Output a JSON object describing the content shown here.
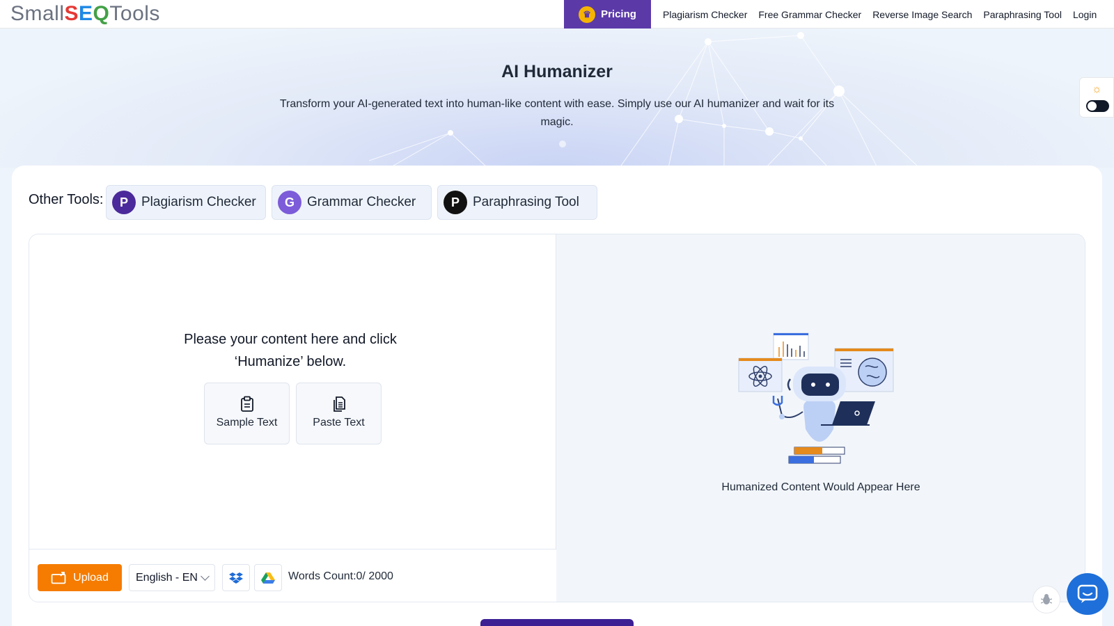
{
  "header": {
    "logo_prefix": "Small",
    "logo_s": "S",
    "logo_e": "E",
    "logo_o": "Q",
    "logo_suffix": "Tools",
    "pricing_label": "Pricing",
    "nav": [
      "Plagiarism Checker",
      "Free Grammar Checker",
      "Reverse Image Search",
      "Paraphrasing Tool",
      "Login"
    ]
  },
  "hero": {
    "title": "AI Humanizer",
    "subtitle": "Transform your AI-generated text into human-like content with ease. Simply use our AI humanizer and wait for its magic."
  },
  "other_tools": {
    "label": "Other Tools:",
    "items": [
      {
        "badge": "P",
        "label": "Plagiarism Checker",
        "color": "#4b2a9b"
      },
      {
        "badge": "G",
        "label": "Grammar Checker",
        "color": "#7c5cd9"
      },
      {
        "badge": "P",
        "label": "Paraphrasing Tool",
        "color": "#111111"
      }
    ]
  },
  "editor": {
    "prompt": "Please your content here and click ‘Humanize’ below.",
    "sample_label": "Sample Text",
    "paste_label": "Paste Text",
    "upload_label": "Upload",
    "language": "English - EN",
    "words_count": "Words Count:0/ 2000",
    "result_placeholder": "Humanized Content Would Appear Here"
  },
  "colors": {
    "brand_purple": "#5b3aa8",
    "upload_orange": "#f57c00",
    "chat_blue": "#1e6fd9"
  },
  "icons": [
    "crown-icon",
    "sun-icon",
    "clipboard-icon",
    "paste-icon",
    "upload-icon",
    "dropbox-icon",
    "google-drive-icon",
    "bug-icon",
    "chat-icon"
  ]
}
